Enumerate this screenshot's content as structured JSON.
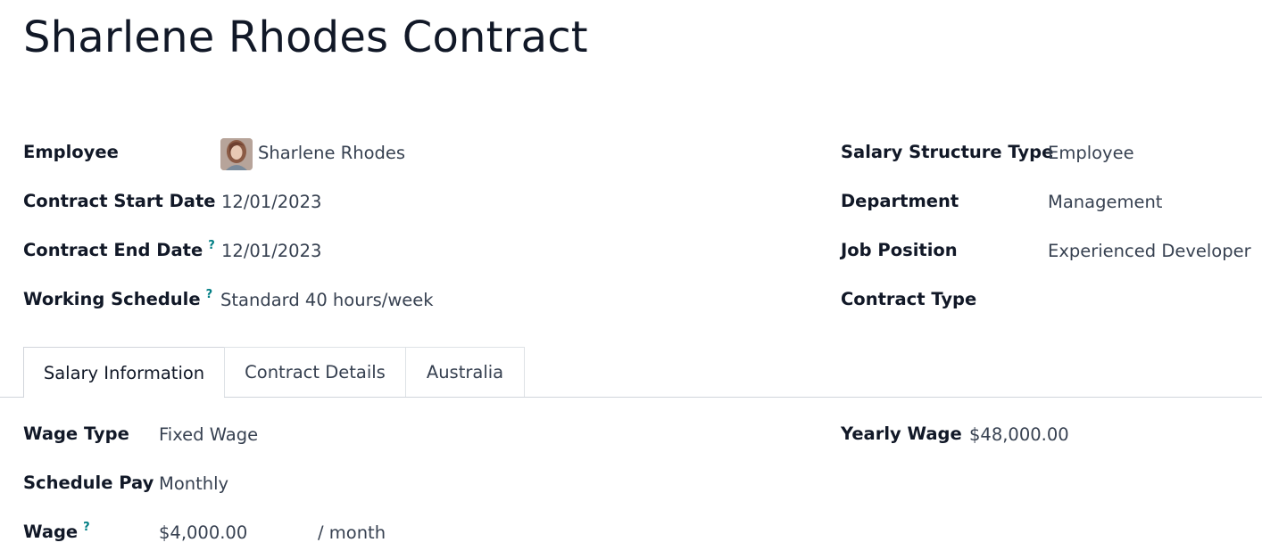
{
  "form": {
    "title": "Sharlene Rhodes Contract",
    "left_fields": [
      {
        "label": "Employee",
        "value": "Sharlene Rhodes",
        "help": ""
      },
      {
        "label": "Contract Start Date",
        "value": "12/01/2023",
        "help": ""
      },
      {
        "label": "Contract End Date",
        "value": "12/01/2023",
        "help": "?"
      },
      {
        "label": "Working Schedule",
        "value": "Standard 40 hours/week",
        "help": "?"
      }
    ],
    "right_fields": [
      {
        "label": "Salary Structure Type",
        "value": "Employee"
      },
      {
        "label": "Department",
        "value": "Management"
      },
      {
        "label": "Job Position",
        "value": "Experienced Developer"
      },
      {
        "label": "Contract Type",
        "value": ""
      }
    ]
  },
  "tabs": [
    {
      "label": "Salary Information",
      "active": true
    },
    {
      "label": "Contract Details",
      "active": false
    },
    {
      "label": "Australia",
      "active": false
    }
  ],
  "salary": {
    "wage_type_label": "Wage Type",
    "wage_type_value": "Fixed Wage",
    "schedule_pay_label": "Schedule Pay",
    "schedule_pay_value": "Monthly",
    "wage_label": "Wage",
    "wage_help": "?",
    "wage_value": "$4,000.00",
    "wage_unit": "/ month",
    "yearly_wage_label": "Yearly Wage",
    "yearly_wage_value": "$48,000.00"
  },
  "colors": {
    "help_accent": "#017e84",
    "label": "#111827",
    "value": "#374151"
  }
}
